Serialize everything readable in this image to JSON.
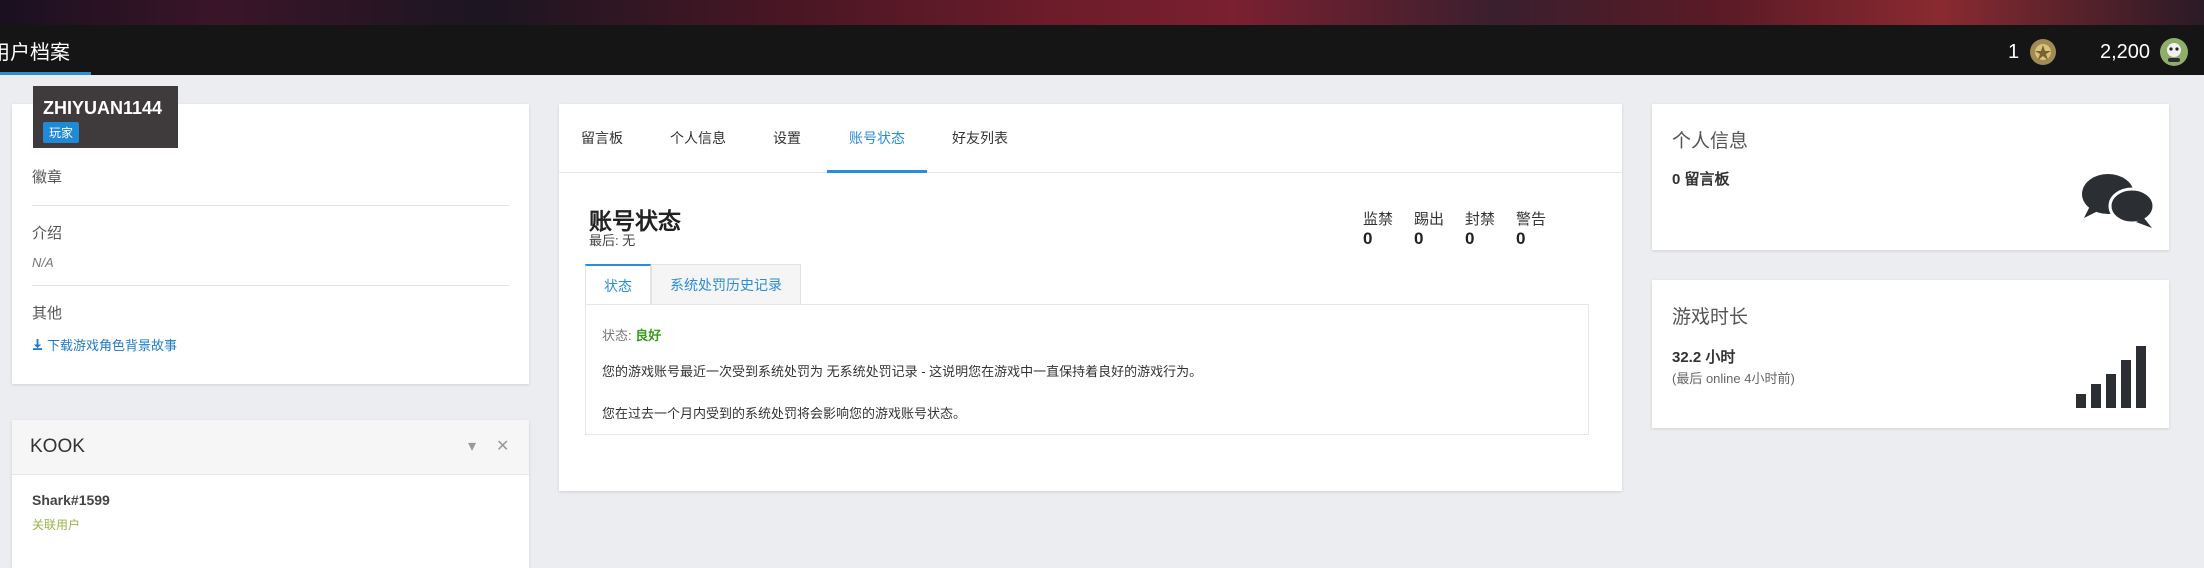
{
  "header": {
    "title": "用户档案",
    "rank_count": "1",
    "points": "2,200"
  },
  "profile": {
    "username": "ZHIYUAN1144",
    "role": "玩家",
    "badges_label": "徽章",
    "intro_label": "介绍",
    "intro_value": "N/A",
    "other_label": "其他",
    "download_link": "下载游戏角色背景故事"
  },
  "kook": {
    "title": "KOOK",
    "account": "Shark#1599",
    "linked_label": "关联用户"
  },
  "main": {
    "tabs": [
      {
        "label": "留言板"
      },
      {
        "label": "个人信息"
      },
      {
        "label": "设置"
      },
      {
        "label": "账号状态"
      },
      {
        "label": "好友列表"
      }
    ],
    "title": "账号状态",
    "last": "最后: 无",
    "counters": [
      {
        "label": "监禁",
        "value": "0"
      },
      {
        "label": "踢出",
        "value": "0"
      },
      {
        "label": "封禁",
        "value": "0"
      },
      {
        "label": "警告",
        "value": "0"
      }
    ],
    "subtabs": [
      {
        "label": "状态"
      },
      {
        "label": "系统处罚历史记录"
      }
    ],
    "status_label": "状态:",
    "status_value": "良好",
    "paragraph1": "您的游戏账号最近一次受到系统处罚为 无系统处罚记录 - 这说明您在游戏中一直保持着良好的游戏行为。",
    "paragraph2": "您在过去一个月内受到的系统处罚将会影响您的游戏账号状态。"
  },
  "right": {
    "info_title": "个人信息",
    "info_value": "0 留言板",
    "playtime_title": "游戏时长",
    "playtime_value": "32.2 小时",
    "playtime_sub": "(最后 online 4小时前)"
  },
  "colors": {
    "accent": "#2d8cd8",
    "good": "#3b9a1c",
    "topbar": "#151515"
  }
}
